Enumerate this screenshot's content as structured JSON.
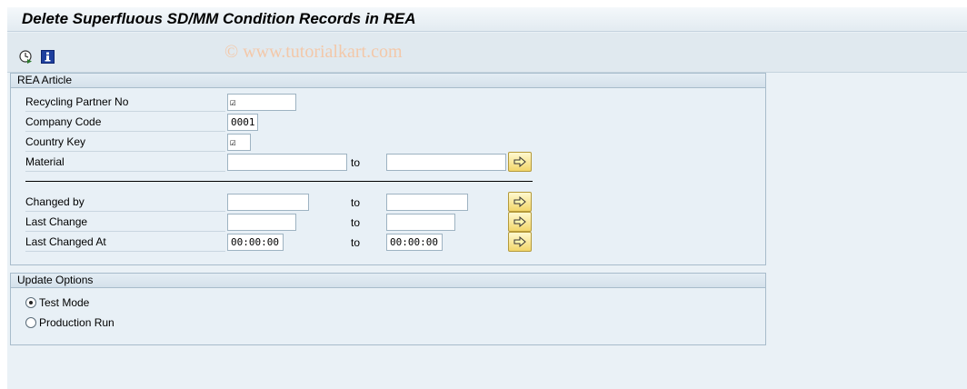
{
  "window": {
    "title": "Delete Superfluous SD/MM Condition Records in REA"
  },
  "toolbar": {
    "watermark": "© www.tutorialkart.com",
    "execute_icon": "execute-icon",
    "info_icon": "info-icon"
  },
  "selection": {
    "header": "REA Article",
    "recycling_partner": {
      "label": "Recycling Partner No",
      "value": "☑"
    },
    "company_code": {
      "label": "Company Code",
      "value": "0001"
    },
    "country_key": {
      "label": "Country Key",
      "value": "☑"
    },
    "material": {
      "label": "Material",
      "from": "",
      "to_label": "to",
      "to": ""
    },
    "changed_by": {
      "label": "Changed by",
      "from": "",
      "to_label": "to",
      "to": ""
    },
    "last_change": {
      "label": "Last Change",
      "from": "",
      "to_label": "to",
      "to": ""
    },
    "last_changed_at": {
      "label": "Last Changed At",
      "from": "00:00:00",
      "to_label": "to",
      "to": "00:00:00"
    }
  },
  "update_options": {
    "header": "Update Options",
    "options": [
      {
        "label": "Test Mode",
        "selected": true
      },
      {
        "label": "Production Run",
        "selected": false
      }
    ]
  },
  "colors": {
    "window_bg": "#eaf1f6",
    "button_yellow": "#f2d66a",
    "watermark": "#f3c8a9"
  }
}
